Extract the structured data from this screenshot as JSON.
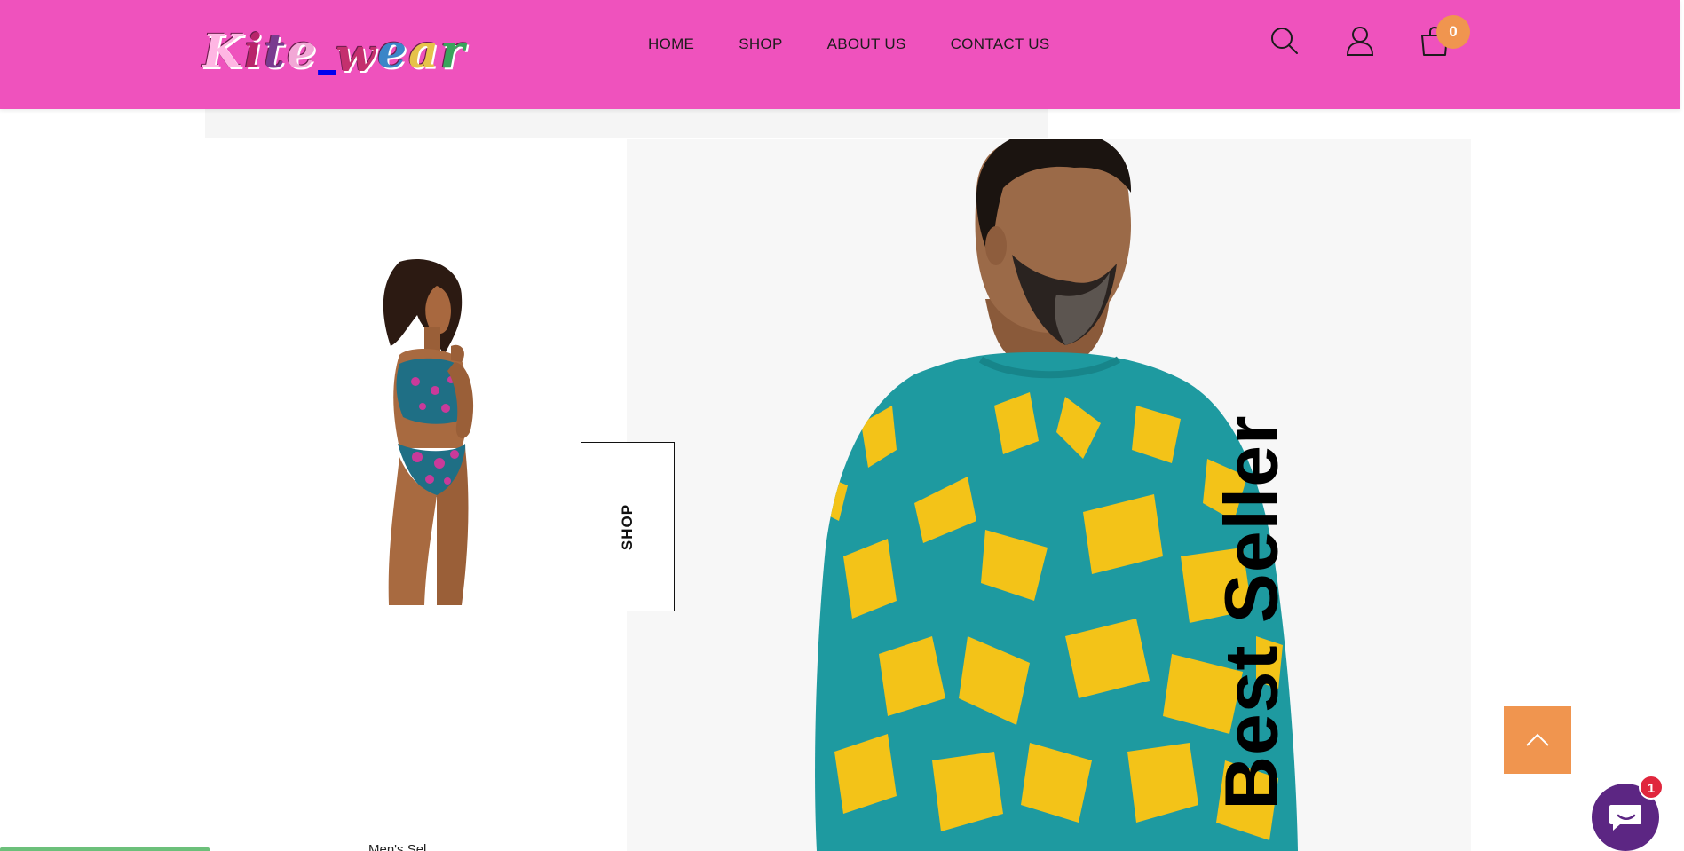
{
  "header": {
    "logo_text": "Kitewear",
    "nav": [
      "HOME",
      "SHOP",
      "ABOUT US",
      "CONTACT US"
    ],
    "icons": [
      "search-icon",
      "user-icon",
      "cart-icon"
    ],
    "cart_count": "0"
  },
  "hero": {
    "shop_label": "SHOP",
    "best_seller_label": "Best Seller",
    "partial_caption": "Men's Sel..."
  },
  "floating": {
    "scroll_top_icon": "chevron-up-icon",
    "chat_icon": "chat-bubble-icon",
    "chat_badge": "1"
  },
  "colors": {
    "header_bg": "#ef52bd",
    "accent_orange": "#f0954f",
    "chat_purple": "#5c2683",
    "badge_red": "#e0263d",
    "shirt_teal": "#1e9aa0",
    "shirt_yellow": "#f3c318"
  }
}
